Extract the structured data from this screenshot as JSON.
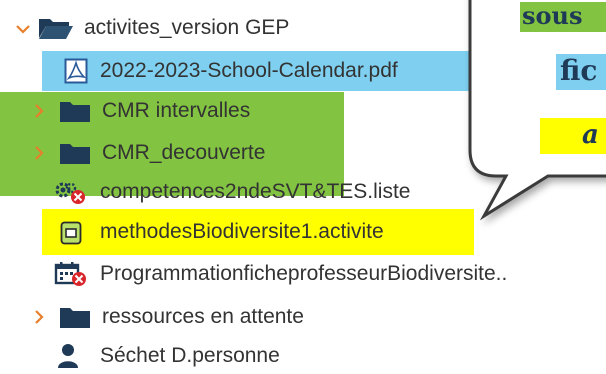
{
  "tree": {
    "root_folder": {
      "label": "activites_version GEP",
      "expanded": true
    },
    "items": [
      {
        "label": "2022-2023-School-Calendar.pdf",
        "icon": "pdf-icon"
      },
      {
        "label": "CMR intervalles",
        "icon": "folder-icon",
        "collapsed": true
      },
      {
        "label": "CMR_decouverte",
        "icon": "folder-icon",
        "collapsed": true
      },
      {
        "label": "competences2ndeSVT&TES.liste",
        "icon": "competences-list-icon"
      },
      {
        "label": "methodesBiodiversite1.activite",
        "icon": "activity-icon"
      },
      {
        "label": "ProgrammationficheprofesseurBiodiversite..",
        "icon": "calendar-error-icon"
      },
      {
        "label": "ressources en attente",
        "icon": "folder-icon",
        "collapsed": true
      },
      {
        "label": "Séchet D.personne",
        "icon": "person-icon"
      }
    ]
  },
  "callout": {
    "line1": "sous",
    "line2": "fic",
    "line3": "a"
  },
  "colors": {
    "highlight_blue": "#7fd0f0",
    "highlight_green": "#82c341",
    "highlight_yellow": "#ffff00",
    "folder": "#1f3a56",
    "chevron": "#e87f2c",
    "text": "#333333"
  }
}
